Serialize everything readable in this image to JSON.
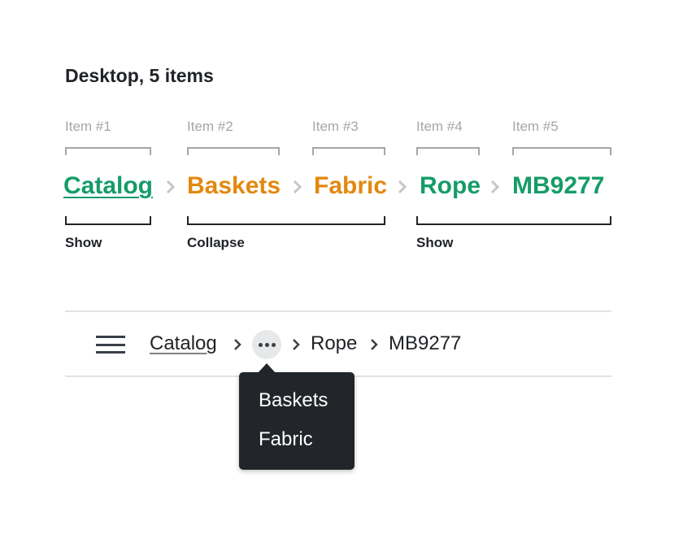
{
  "title": "Desktop, 5 items",
  "item_labels": [
    "Item #1",
    "Item #2",
    "Item #3",
    "Item #4",
    "Item #5"
  ],
  "colors": {
    "show": "#159c6a",
    "collapse": "#e3880f",
    "text": "#202327",
    "muted": "#a3a6aa",
    "popover_bg": "#22252a"
  },
  "crumbs": [
    {
      "label": "Catalog",
      "state": "show",
      "link": true
    },
    {
      "label": "Baskets",
      "state": "collapse"
    },
    {
      "label": "Fabric",
      "state": "collapse"
    },
    {
      "label": "Rope",
      "state": "show"
    },
    {
      "label": "MB9277",
      "state": "show"
    }
  ],
  "annotations": [
    "Show",
    "Collapse",
    "Show"
  ],
  "collapsed_breadcrumb": {
    "menu_icon": "hamburger-menu-icon",
    "items": [
      "Catalog",
      "Rope",
      "MB9277"
    ],
    "overflow_icon": "more-horizontal-icon",
    "popover_items": [
      "Baskets",
      "Fabric"
    ]
  }
}
